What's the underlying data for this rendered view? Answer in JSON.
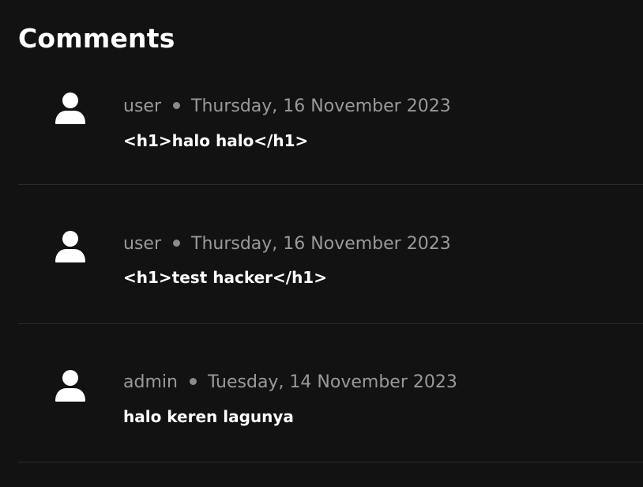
{
  "section": {
    "title": "Comments"
  },
  "comments": [
    {
      "author": "user",
      "date": "Thursday, 16 November 2023",
      "text": "<h1>halo halo</h1>"
    },
    {
      "author": "user",
      "date": "Thursday, 16 November 2023",
      "text": "<h1>test hacker</h1>"
    },
    {
      "author": "admin",
      "date": "Tuesday, 14 November 2023",
      "text": "halo keren lagunya"
    }
  ],
  "icons": {
    "avatar": "user-avatar-icon"
  },
  "colors": {
    "background": "#121212",
    "text_primary": "#ffffff",
    "text_muted": "#9a9a9a",
    "divider": "#2b2b2b"
  }
}
